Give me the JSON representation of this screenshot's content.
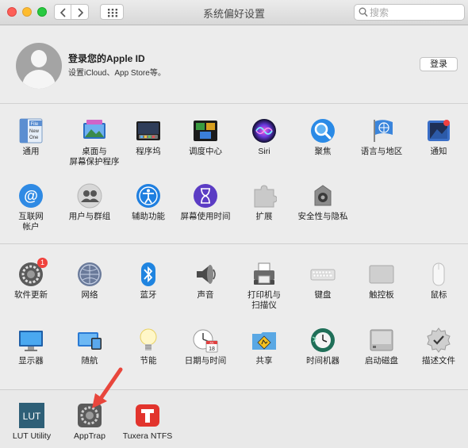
{
  "window": {
    "title": "系统偏好设置"
  },
  "search": {
    "placeholder": "搜索",
    "value": ""
  },
  "account": {
    "title": "登录您的Apple ID",
    "subtitle": "设置iCloud、App Store等。",
    "sign_in_label": "登录"
  },
  "section1": [
    {
      "label": "通用",
      "icon": "general-icon"
    },
    {
      "label": "桌面与\n屏幕保护程序",
      "icon": "desktop-icon"
    },
    {
      "label": "程序坞",
      "icon": "dock-icon"
    },
    {
      "label": "调度中心",
      "icon": "mission-control-icon"
    },
    {
      "label": "Siri",
      "icon": "siri-icon"
    },
    {
      "label": "聚焦",
      "icon": "spotlight-icon"
    },
    {
      "label": "语言与地区",
      "icon": "language-region-icon"
    },
    {
      "label": "通知",
      "icon": "notifications-icon"
    },
    {
      "label": "互联网\n帐户",
      "icon": "internet-accounts-icon"
    },
    {
      "label": "用户与群组",
      "icon": "users-groups-icon"
    },
    {
      "label": "辅助功能",
      "icon": "accessibility-icon"
    },
    {
      "label": "屏幕使用时间",
      "icon": "screen-time-icon"
    },
    {
      "label": "扩展",
      "icon": "extensions-icon"
    },
    {
      "label": "安全性与隐私",
      "icon": "security-privacy-icon"
    }
  ],
  "section2": [
    {
      "label": "软件更新",
      "icon": "software-update-icon",
      "badge": "1"
    },
    {
      "label": "网络",
      "icon": "network-icon"
    },
    {
      "label": "蓝牙",
      "icon": "bluetooth-icon"
    },
    {
      "label": "声音",
      "icon": "sound-icon"
    },
    {
      "label": "打印机与\n扫描仪",
      "icon": "printers-scanners-icon"
    },
    {
      "label": "键盘",
      "icon": "keyboard-icon"
    },
    {
      "label": "触控板",
      "icon": "trackpad-icon"
    },
    {
      "label": "鼠标",
      "icon": "mouse-icon"
    },
    {
      "label": "显示器",
      "icon": "displays-icon"
    },
    {
      "label": "随航",
      "icon": "sidecar-icon"
    },
    {
      "label": "节能",
      "icon": "energy-saver-icon"
    },
    {
      "label": "日期与时间",
      "icon": "date-time-icon"
    },
    {
      "label": "共享",
      "icon": "sharing-icon"
    },
    {
      "label": "时间机器",
      "icon": "time-machine-icon"
    },
    {
      "label": "启动磁盘",
      "icon": "startup-disk-icon"
    },
    {
      "label": "描述文件",
      "icon": "profiles-icon"
    }
  ],
  "section3": [
    {
      "label": "LUT Utility",
      "icon": "lut-utility-icon"
    },
    {
      "label": "AppTrap",
      "icon": "apptrap-icon"
    },
    {
      "label": "Tuxera NTFS",
      "icon": "tuxera-ntfs-icon"
    }
  ],
  "calendar_icon_text": {
    "month": "JUL",
    "day": "18"
  },
  "general_icon_text": {
    "line1": "File",
    "line2": "New",
    "line3": "One"
  },
  "lut_icon_text": "LUT",
  "colors": {
    "annotation_arrow": "#e8463c",
    "badge": "#f0413c"
  }
}
